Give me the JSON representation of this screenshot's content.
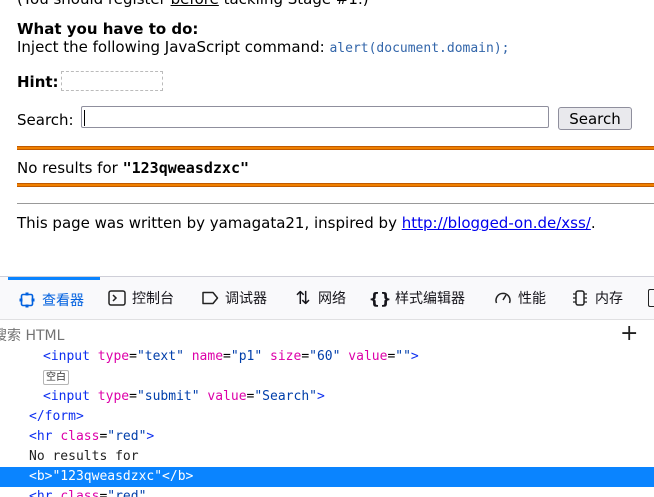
{
  "page": {
    "cut_text_pre": "(You should register ",
    "cut_text_link": "before",
    "cut_text_post": " tackling Stage #1.)",
    "todo_heading": "What you have to do:",
    "instruction_text": "Inject the following JavaScript command: ",
    "command": "alert(document.domain);",
    "hint_label": "Hint:",
    "search_label": "Search:",
    "search_value": "",
    "search_button": "Search",
    "results_prefix": "No results for ",
    "results_query": "\"123qweasdzxc\"",
    "footer_prefix": "This page was written by yamagata21, inspired by ",
    "footer_link": "http://blogged-on.de/xss/",
    "footer_suffix": "."
  },
  "devtools": {
    "tabs": [
      {
        "label": "查看器",
        "icon": "inspector-icon"
      },
      {
        "label": "控制台",
        "icon": "console-icon"
      },
      {
        "label": "调试器",
        "icon": "debugger-icon"
      },
      {
        "label": "网络",
        "icon": "network-icon"
      },
      {
        "label": "样式编辑器",
        "icon": "style-editor-icon"
      },
      {
        "label": "性能",
        "icon": "performance-icon"
      },
      {
        "label": "内存",
        "icon": "memory-icon"
      }
    ],
    "search_placeholder": "搜索 HTML",
    "whitespace_badge": "空白",
    "markup": {
      "line1_tag": "<input",
      "line1_a1": "type",
      "line1_v1": "\"text\"",
      "line1_a2": "name",
      "line1_v2": "\"p1\"",
      "line1_a3": "size",
      "line1_v3": "\"60\"",
      "line1_a4": "value",
      "line1_v4": "\"\"",
      "line1_close": ">",
      "line3_tag": "<input",
      "line3_a1": "type",
      "line3_v1": "\"submit\"",
      "line3_a2": "value",
      "line3_v2": "\"Search\"",
      "line3_close": ">",
      "line4": "</form>",
      "line5_tag": "<hr",
      "line5_a1": "class",
      "line5_v1": "\"red\"",
      "line5_close": ">",
      "line6": "No results for",
      "line7": "<b>\"123qweasdzxc\"</b>",
      "line8_tag": "<hr",
      "line8_a1": "class",
      "line8_v1": "\"red\""
    }
  }
}
